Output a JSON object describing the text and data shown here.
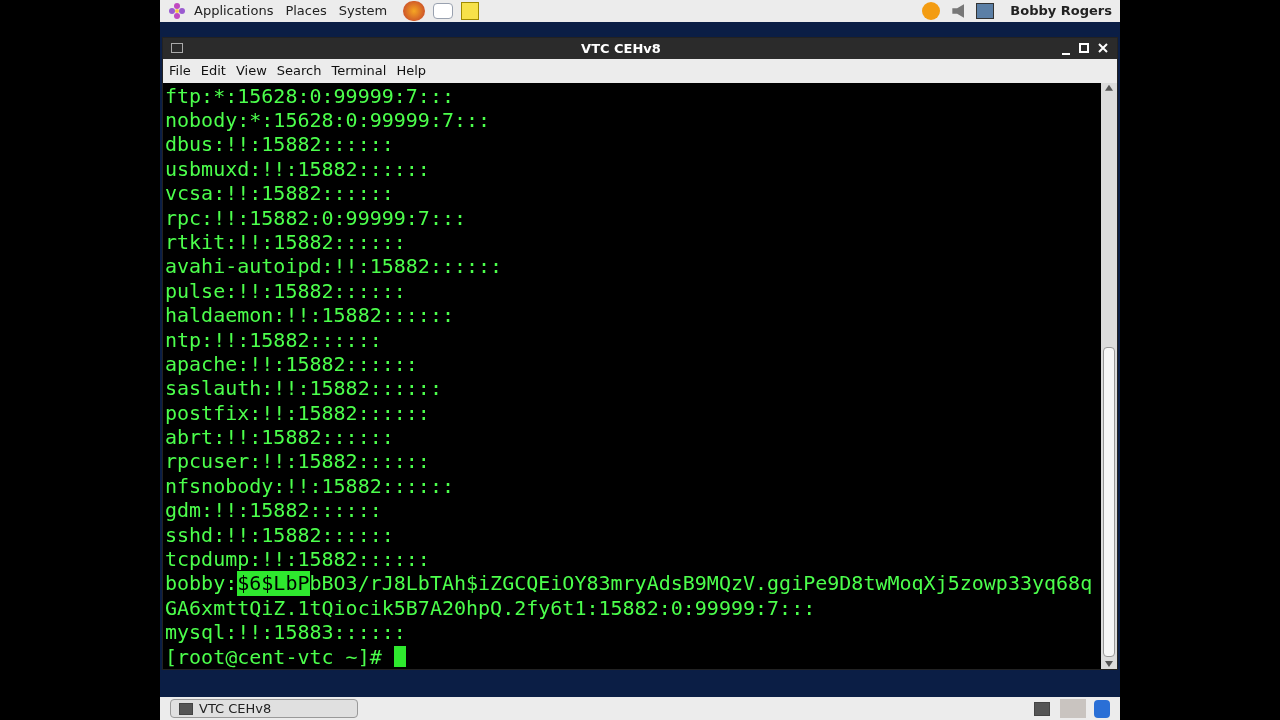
{
  "top_panel": {
    "menus": [
      "Applications",
      "Places",
      "System"
    ],
    "user": "Bobby Rogers"
  },
  "window": {
    "title": "VTC CEHv8"
  },
  "menu_bar": [
    "File",
    "Edit",
    "View",
    "Search",
    "Terminal",
    "Help"
  ],
  "terminal": {
    "lines": [
      {
        "kind": "plain",
        "text": "ftp:*:15628:0:99999:7:::"
      },
      {
        "kind": "plain",
        "text": "nobody:*:15628:0:99999:7:::"
      },
      {
        "kind": "plain",
        "text": "dbus:!!:15882::::::"
      },
      {
        "kind": "plain",
        "text": "usbmuxd:!!:15882::::::"
      },
      {
        "kind": "plain",
        "text": "vcsa:!!:15882::::::"
      },
      {
        "kind": "plain",
        "text": "rpc:!!:15882:0:99999:7:::"
      },
      {
        "kind": "plain",
        "text": "rtkit:!!:15882::::::"
      },
      {
        "kind": "plain",
        "text": "avahi-autoipd:!!:15882::::::"
      },
      {
        "kind": "plain",
        "text": "pulse:!!:15882::::::"
      },
      {
        "kind": "plain",
        "text": "haldaemon:!!:15882::::::"
      },
      {
        "kind": "plain",
        "text": "ntp:!!:15882::::::"
      },
      {
        "kind": "plain",
        "text": "apache:!!:15882::::::"
      },
      {
        "kind": "plain",
        "text": "saslauth:!!:15882::::::"
      },
      {
        "kind": "plain",
        "text": "postfix:!!:15882::::::"
      },
      {
        "kind": "plain",
        "text": "abrt:!!:15882::::::"
      },
      {
        "kind": "plain",
        "text": "rpcuser:!!:15882::::::"
      },
      {
        "kind": "plain",
        "text": "nfsnobody:!!:15882::::::"
      },
      {
        "kind": "plain",
        "text": "gdm:!!:15882::::::"
      },
      {
        "kind": "plain",
        "text": "sshd:!!:15882::::::"
      },
      {
        "kind": "plain",
        "text": "tcpdump:!!:15882::::::"
      },
      {
        "kind": "selection",
        "before": "bobby:",
        "selected": "$6$LbP",
        "after": "bBO3/rJ8LbTAh$iZGCQEiOY83mryAdsB9MQzV.ggiPe9D8twMoqXj5zowp33yq68q"
      },
      {
        "kind": "plain",
        "text": "GA6xmttQiZ.1tQiocik5B7A20hpQ.2fy6t1:15882:0:99999:7:::"
      },
      {
        "kind": "plain",
        "text": "mysql:!!:15883::::::"
      },
      {
        "kind": "prompt",
        "text": "[root@cent-vtc ~]# "
      }
    ]
  },
  "taskbar": {
    "items": [
      {
        "label": "VTC CEHv8",
        "selected": false
      }
    ]
  }
}
